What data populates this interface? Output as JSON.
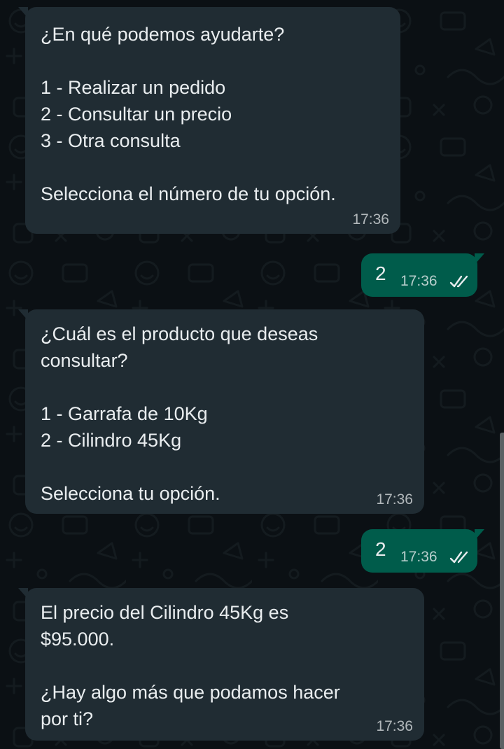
{
  "colors": {
    "background": "#0b1014",
    "incoming_bubble": "#202c33",
    "outgoing_bubble": "#005c4b",
    "text": "#e9edef",
    "read_ticks": "#e9edef"
  },
  "messages": [
    {
      "direction": "incoming",
      "lines": [
        "¿En qué podemos ayudarte?",
        "",
        "1 - Realizar un pedido",
        "2 - Consultar un precio",
        "3 - Otra consulta",
        "",
        "Selecciona el número de tu opción."
      ],
      "time": "17:36"
    },
    {
      "direction": "outgoing",
      "text": "2",
      "time": "17:36",
      "status_icon": "double-check-icon"
    },
    {
      "direction": "incoming",
      "lines": [
        "¿Cuál es el producto que deseas",
        "consultar?",
        "",
        "1 - Garrafa de 10Kg",
        "2 - Cilindro 45Kg",
        "",
        "Selecciona tu opción."
      ],
      "time": "17:36"
    },
    {
      "direction": "outgoing",
      "text": "2",
      "time": "17:36",
      "status_icon": "double-check-icon"
    },
    {
      "direction": "incoming",
      "lines": [
        "El precio del Cilindro 45Kg es",
        "$95.000.",
        "",
        "¿Hay algo más que podamos hacer",
        "por ti?"
      ],
      "time": "17:36"
    }
  ]
}
